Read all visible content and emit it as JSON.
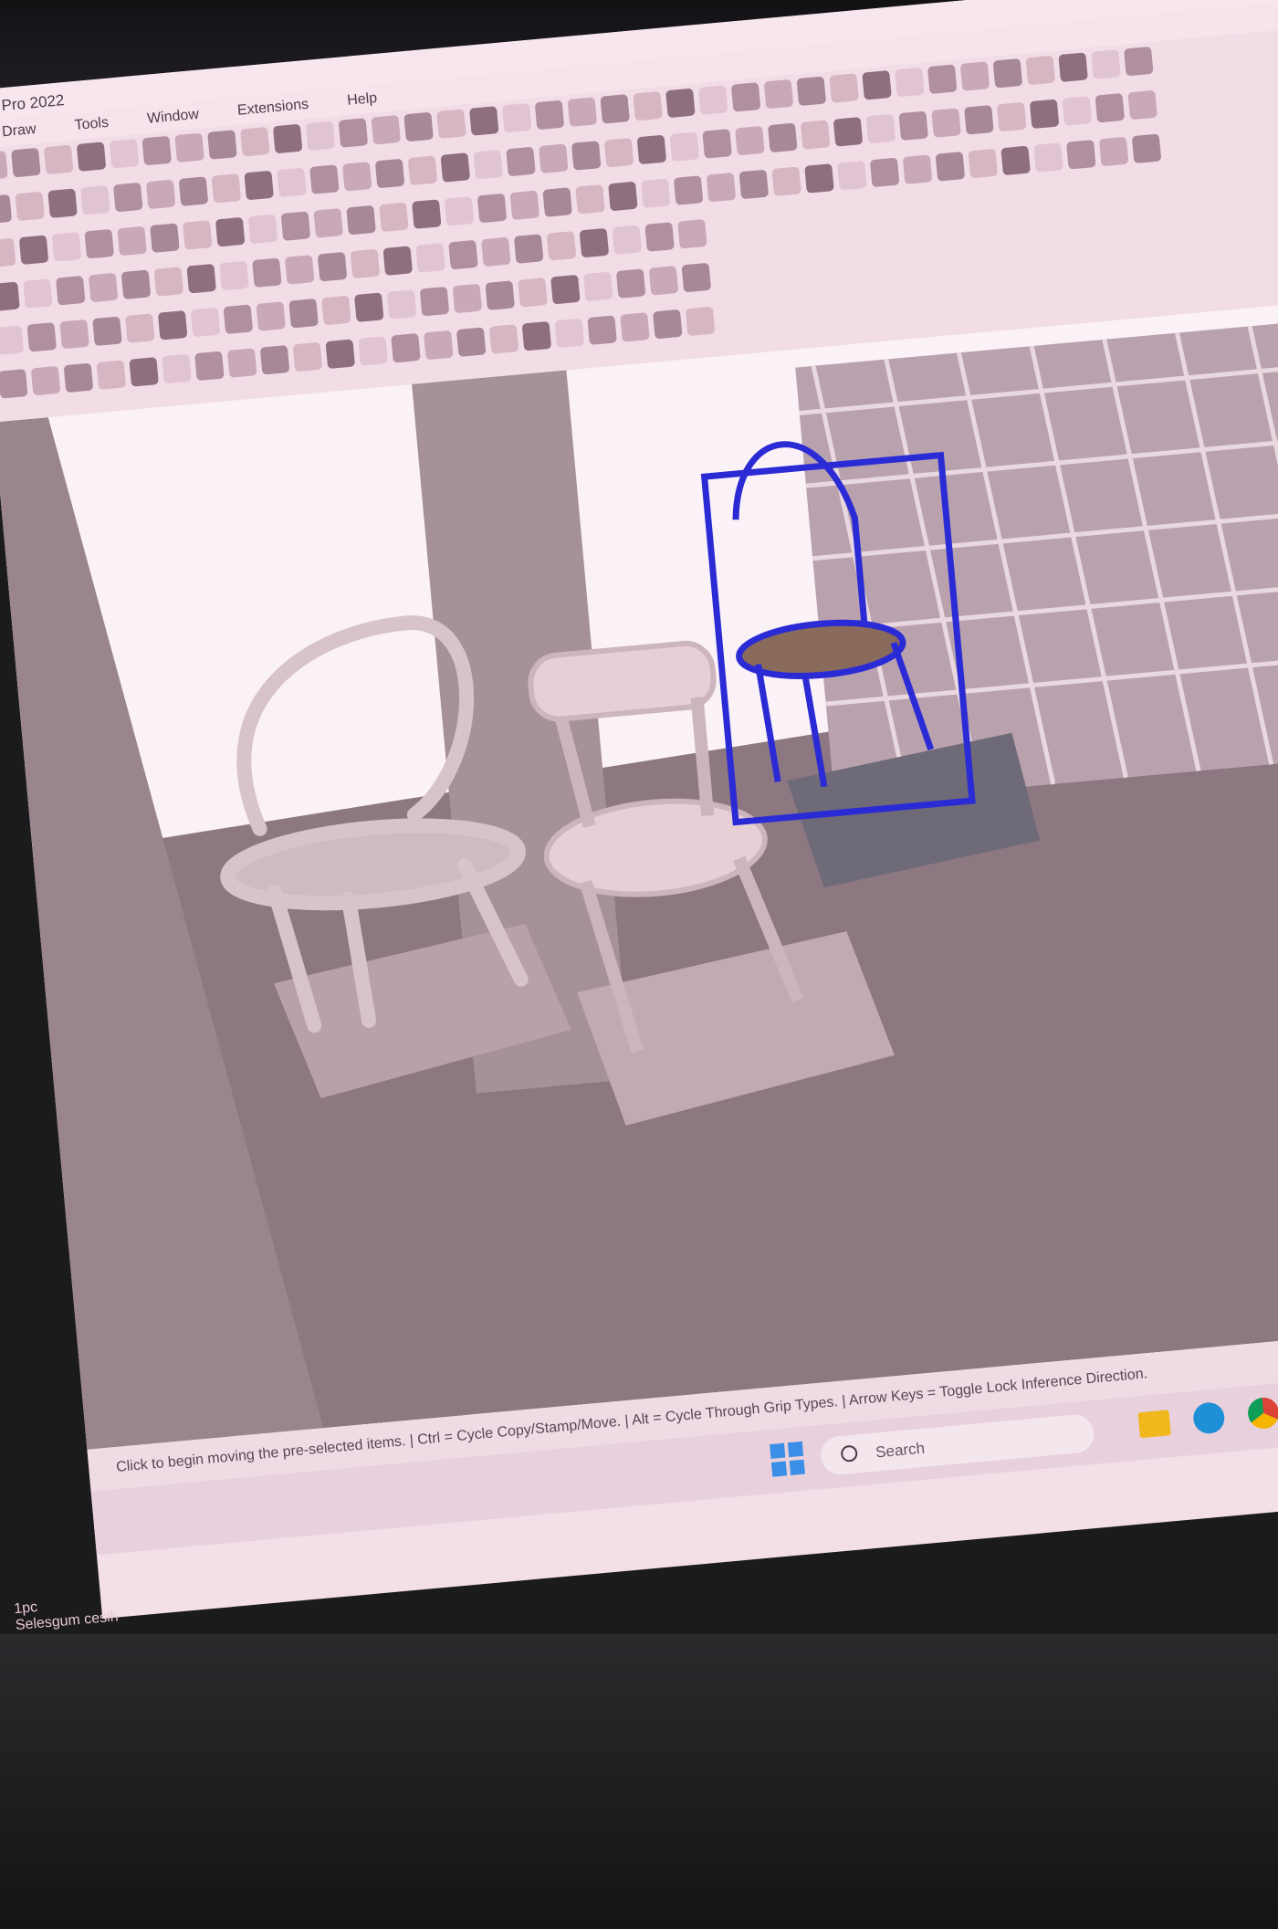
{
  "window": {
    "title": "Pro 2022"
  },
  "menus": [
    "Draw",
    "Tools",
    "Window",
    "Extensions",
    "Help"
  ],
  "status_bar": {
    "hint": "Click to begin moving the pre-selected items. | Ctrl = Cycle Copy/Stamp/Move. | Alt = Cycle Through Grip Types. | Arrow Keys = Toggle Lock Inference Direction."
  },
  "taskbar": {
    "search_placeholder": "Search"
  },
  "overlay": {
    "line1": "1pc",
    "line2": "Selesgum cesih"
  },
  "icons": [
    "windows-icon",
    "search-icon",
    "folder-icon",
    "edge-icon",
    "chrome-icon"
  ],
  "colors": {
    "screen": "#f3dfe8",
    "selection": "#2b2bd6",
    "chair": "#e7cfd6",
    "floor": "#8d7881"
  }
}
